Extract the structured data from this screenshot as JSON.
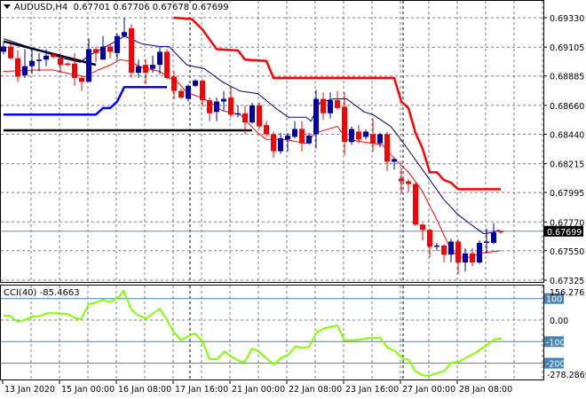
{
  "header": {
    "symbol": "AUDUSD,H4",
    "open": "0.67701",
    "high": "0.67706",
    "low": "0.67678",
    "close": "0.67699"
  },
  "colors": {
    "bull": "#0000b0",
    "bear": "#ff0000",
    "ma_slow": "#000080",
    "ma_fast": "#ff0000",
    "stop_red": "#ff0000",
    "stop_blue": "#0000ff",
    "trend": "#000000",
    "cci": "#7fff00",
    "level_box": "#4682b4",
    "grid": "#708090"
  },
  "price_axis": {
    "labels": [
      "0.69330",
      "0.69105",
      "0.68885",
      "0.68660",
      "0.68440",
      "0.68215",
      "0.67995",
      "0.67770",
      "0.67550",
      "0.67325"
    ],
    "current_price": "0.67699"
  },
  "time_axis": {
    "labels": [
      {
        "i": 0,
        "text": "13 Jan 2020"
      },
      {
        "i": 8,
        "text": "15 Jan 00:00"
      },
      {
        "i": 16,
        "text": "16 Jan 08:00"
      },
      {
        "i": 24,
        "text": "17 Jan 16:00"
      },
      {
        "i": 32,
        "text": "21 Jan 00:00"
      },
      {
        "i": 40,
        "text": "22 Jan 08:00"
      },
      {
        "i": 48,
        "text": "23 Jan 16:00"
      },
      {
        "i": 56,
        "text": "27 Jan 00:00"
      },
      {
        "i": 64,
        "text": "28 Jan 08:00"
      }
    ],
    "period_separators": [
      26,
      56
    ]
  },
  "cci_panel": {
    "label": "CCI(40) -85.4663",
    "max_label": "156.276",
    "min_label": "-278.2869",
    "zero_label": "0.00",
    "levels": [
      "100",
      "-100",
      "-200"
    ]
  },
  "chart_data": {
    "type": "candlestick",
    "title": "AUDUSD,H4",
    "ylim": [
      0.67325,
      0.6933
    ],
    "candles": [
      [
        0.6907,
        0.6914,
        0.6905,
        0.6911
      ],
      [
        0.6911,
        0.6913,
        0.6901,
        0.6902
      ],
      [
        0.6902,
        0.6908,
        0.6884,
        0.6888
      ],
      [
        0.6889,
        0.6909,
        0.6887,
        0.6896
      ],
      [
        0.6896,
        0.6909,
        0.689,
        0.69
      ],
      [
        0.69,
        0.6906,
        0.6892,
        0.6901
      ],
      [
        0.6901,
        0.6909,
        0.6896,
        0.6904
      ],
      [
        0.6905,
        0.6906,
        0.6902,
        0.6903
      ],
      [
        0.6902,
        0.6906,
        0.6891,
        0.6897
      ],
      [
        0.6898,
        0.6899,
        0.6896,
        0.6897
      ],
      [
        0.6898,
        0.6906,
        0.6881,
        0.6887
      ],
      [
        0.6887,
        0.6888,
        0.6877,
        0.6884
      ],
      [
        0.6884,
        0.6917,
        0.6884,
        0.6909
      ],
      [
        0.6909,
        0.6911,
        0.6899,
        0.6906
      ],
      [
        0.6901,
        0.6919,
        0.6901,
        0.6911
      ],
      [
        0.6911,
        0.6913,
        0.6902,
        0.6907
      ],
      [
        0.6906,
        0.6921,
        0.6901,
        0.6919
      ],
      [
        0.6919,
        0.6933,
        0.6918,
        0.6922
      ],
      [
        0.6925,
        0.6928,
        0.6887,
        0.6891
      ],
      [
        0.6891,
        0.6901,
        0.6887,
        0.6896
      ],
      [
        0.6897,
        0.6901,
        0.6882,
        0.6891
      ],
      [
        0.6894,
        0.6904,
        0.6891,
        0.6897
      ],
      [
        0.6897,
        0.6911,
        0.689,
        0.6907
      ],
      [
        0.6907,
        0.6909,
        0.6886,
        0.6887
      ],
      [
        0.6888,
        0.6892,
        0.6871,
        0.6877
      ],
      [
        0.6877,
        0.6879,
        0.6871,
        0.6872
      ],
      [
        0.6871,
        0.6882,
        0.6869,
        0.6881
      ],
      [
        0.6881,
        0.6886,
        0.688,
        0.6885
      ],
      [
        0.6885,
        0.6886,
        0.6865,
        0.687
      ],
      [
        0.687,
        0.6872,
        0.6854,
        0.686
      ],
      [
        0.6861,
        0.6872,
        0.6854,
        0.6869
      ],
      [
        0.6869,
        0.6877,
        0.6862,
        0.6871
      ],
      [
        0.6872,
        0.688,
        0.6857,
        0.6859
      ],
      [
        0.6859,
        0.6866,
        0.6857,
        0.686
      ],
      [
        0.686,
        0.6866,
        0.6844,
        0.6853
      ],
      [
        0.6853,
        0.6868,
        0.6852,
        0.6866
      ],
      [
        0.6866,
        0.6868,
        0.6848,
        0.685
      ],
      [
        0.6851,
        0.6854,
        0.6842,
        0.6844
      ],
      [
        0.6844,
        0.6846,
        0.6826,
        0.6831
      ],
      [
        0.6831,
        0.6845,
        0.6829,
        0.6841
      ],
      [
        0.684,
        0.6845,
        0.6831,
        0.6843
      ],
      [
        0.6842,
        0.6854,
        0.6841,
        0.6848
      ],
      [
        0.6848,
        0.6854,
        0.6831,
        0.6837
      ],
      [
        0.6837,
        0.6845,
        0.6836,
        0.6843
      ],
      [
        0.6844,
        0.6878,
        0.6833,
        0.6871
      ],
      [
        0.6871,
        0.6876,
        0.6855,
        0.686
      ],
      [
        0.686,
        0.6876,
        0.6856,
        0.687
      ],
      [
        0.687,
        0.6877,
        0.6863,
        0.6864
      ],
      [
        0.6865,
        0.6876,
        0.6828,
        0.6838
      ],
      [
        0.6838,
        0.685,
        0.6836,
        0.6848
      ],
      [
        0.6846,
        0.6851,
        0.6837,
        0.684
      ],
      [
        0.6842,
        0.6848,
        0.684,
        0.6846
      ],
      [
        0.6844,
        0.6856,
        0.6831,
        0.6837
      ],
      [
        0.6837,
        0.6845,
        0.6834,
        0.6844
      ],
      [
        0.6844,
        0.6846,
        0.6816,
        0.6823
      ],
      [
        0.6823,
        0.6826,
        0.6817,
        0.6825
      ],
      [
        0.681,
        0.6818,
        0.6799,
        0.6808
      ],
      [
        0.6808,
        0.681,
        0.68,
        0.6806
      ],
      [
        0.6806,
        0.6807,
        0.6774,
        0.6775
      ],
      [
        0.6775,
        0.6776,
        0.6763,
        0.6771
      ],
      [
        0.6771,
        0.6772,
        0.675,
        0.6758
      ],
      [
        0.6758,
        0.6761,
        0.6755,
        0.6759
      ],
      [
        0.6759,
        0.676,
        0.6746,
        0.6752
      ],
      [
        0.6752,
        0.6764,
        0.6746,
        0.6762
      ],
      [
        0.6762,
        0.6764,
        0.6737,
        0.6746
      ],
      [
        0.6746,
        0.6757,
        0.6739,
        0.6753
      ],
      [
        0.6753,
        0.6757,
        0.6743,
        0.6746
      ],
      [
        0.6746,
        0.6763,
        0.6745,
        0.6761
      ],
      [
        0.6761,
        0.6772,
        0.6753,
        0.6762
      ],
      [
        0.6761,
        0.6776,
        0.676,
        0.6769
      ],
      [
        0.67701,
        0.67706,
        0.67678,
        0.67699
      ]
    ],
    "ma_slow": [
      [
        0,
        0.6917
      ],
      [
        4.5,
        0.6909
      ],
      [
        8.3,
        0.6902
      ],
      [
        10.8,
        0.6899
      ],
      [
        12,
        0.6904
      ],
      [
        15.8,
        0.6915
      ],
      [
        17,
        0.6919
      ],
      [
        19.5,
        0.6913
      ],
      [
        22,
        0.6911
      ],
      [
        23.3,
        0.6911
      ],
      [
        25.8,
        0.6897
      ],
      [
        28.3,
        0.6894
      ],
      [
        30.8,
        0.6884
      ],
      [
        33.3,
        0.6877
      ],
      [
        35.8,
        0.6875
      ],
      [
        38.3,
        0.6864
      ],
      [
        40.1,
        0.6857
      ],
      [
        42.6,
        0.6857
      ],
      [
        43.3,
        0.6854
      ],
      [
        44.5,
        0.6868
      ],
      [
        46.4,
        0.6871
      ],
      [
        48.3,
        0.6871
      ],
      [
        50.8,
        0.6861
      ],
      [
        52,
        0.6859
      ],
      [
        54.5,
        0.685
      ],
      [
        55.8,
        0.6841
      ],
      [
        57,
        0.6832
      ],
      [
        59.5,
        0.6813
      ],
      [
        62,
        0.6794
      ],
      [
        63.9,
        0.6783
      ],
      [
        65.8,
        0.6775
      ],
      [
        67.6,
        0.6768
      ],
      [
        68.9,
        0.6769
      ],
      [
        69.8,
        0.6771
      ]
    ],
    "ma_fast": [
      [
        0,
        0.6892
      ],
      [
        4.5,
        0.6893
      ],
      [
        7,
        0.6893
      ],
      [
        9.5,
        0.689
      ],
      [
        11.4,
        0.6888
      ],
      [
        13.3,
        0.6893
      ],
      [
        15.1,
        0.6897
      ],
      [
        16.4,
        0.6901
      ],
      [
        17.6,
        0.69
      ],
      [
        19.5,
        0.6895
      ],
      [
        22,
        0.6892
      ],
      [
        23.3,
        0.6887
      ],
      [
        24.5,
        0.6884
      ],
      [
        25.8,
        0.6876
      ],
      [
        28.3,
        0.6871
      ],
      [
        30.8,
        0.6862
      ],
      [
        33.3,
        0.6859
      ],
      [
        35.8,
        0.6845
      ],
      [
        37,
        0.684
      ],
      [
        39.5,
        0.684
      ],
      [
        42.6,
        0.6837
      ],
      [
        43.9,
        0.6845
      ],
      [
        47,
        0.685
      ],
      [
        48.3,
        0.684
      ],
      [
        50.8,
        0.6838
      ],
      [
        53.3,
        0.6836
      ],
      [
        55.1,
        0.6825
      ],
      [
        57,
        0.6815
      ],
      [
        58.9,
        0.6801
      ],
      [
        60.8,
        0.6781
      ],
      [
        62.6,
        0.676
      ],
      [
        63.9,
        0.675
      ],
      [
        65.8,
        0.675
      ],
      [
        67,
        0.6753
      ],
      [
        70,
        0.6755
      ]
    ],
    "stop_red": [
      [
        24,
        0.6933
      ],
      [
        26.5,
        0.6932
      ],
      [
        28,
        0.6924
      ],
      [
        30,
        0.6909
      ],
      [
        33,
        0.6908
      ],
      [
        34,
        0.6901
      ],
      [
        37,
        0.69
      ],
      [
        38,
        0.6887
      ],
      [
        55,
        0.6887
      ],
      [
        56,
        0.6869
      ],
      [
        57,
        0.6864
      ],
      [
        58,
        0.6845
      ],
      [
        59,
        0.6833
      ],
      [
        60,
        0.6815
      ],
      [
        61,
        0.6815
      ],
      [
        62,
        0.6809
      ],
      [
        63,
        0.6807
      ],
      [
        64,
        0.6802
      ],
      [
        70,
        0.6802
      ]
    ],
    "stop_blue": [
      [
        0,
        0.6859
      ],
      [
        13,
        0.6859
      ],
      [
        14,
        0.6864
      ],
      [
        15,
        0.6864
      ],
      [
        16,
        0.6869
      ],
      [
        17,
        0.688
      ],
      [
        23,
        0.688
      ]
    ],
    "trend_lines": [
      [
        [
          0,
          0.6915
        ],
        [
          13,
          0.6897
        ]
      ],
      [
        [
          0,
          0.6847
        ],
        [
          35,
          0.6847
        ]
      ]
    ],
    "cci": {
      "ylim": [
        -278.2869,
        156.276
      ],
      "levels": [
        100,
        0,
        -100,
        -200
      ],
      "points": [
        [
          0,
          21
        ],
        [
          0.9,
          21
        ],
        [
          1.9,
          -7
        ],
        [
          2.9,
          0
        ],
        [
          4,
          17
        ],
        [
          5,
          17
        ],
        [
          6.1,
          32
        ],
        [
          7.4,
          32
        ],
        [
          9,
          28
        ],
        [
          10,
          11
        ],
        [
          10.9,
          3
        ],
        [
          12,
          74
        ],
        [
          13,
          81
        ],
        [
          14,
          94
        ],
        [
          15,
          83
        ],
        [
          16.1,
          104
        ],
        [
          16.9,
          136
        ],
        [
          18,
          49
        ],
        [
          19,
          21
        ],
        [
          20.1,
          7
        ],
        [
          21.1,
          32
        ],
        [
          22,
          53
        ],
        [
          23,
          0
        ],
        [
          24,
          -58
        ],
        [
          25,
          -93
        ],
        [
          25.9,
          -76
        ],
        [
          26.9,
          -62
        ],
        [
          28,
          -97
        ],
        [
          29,
          -181
        ],
        [
          30.1,
          -181
        ],
        [
          31.1,
          -146
        ],
        [
          32.3,
          -174
        ],
        [
          33.3,
          -192
        ],
        [
          34,
          -192
        ],
        [
          35,
          -132
        ],
        [
          35.9,
          -146
        ],
        [
          37,
          -178
        ],
        [
          38.1,
          -206
        ],
        [
          39.1,
          -174
        ],
        [
          40.1,
          -160
        ],
        [
          41.1,
          -122
        ],
        [
          42,
          -129
        ],
        [
          43,
          -125
        ],
        [
          44.1,
          -56
        ],
        [
          45.1,
          -39
        ],
        [
          45.9,
          -32
        ],
        [
          47,
          -25
        ],
        [
          48,
          -94
        ],
        [
          49.4,
          -93
        ],
        [
          50.4,
          -90
        ],
        [
          51.5,
          -83
        ],
        [
          53,
          -83
        ],
        [
          54.1,
          -129
        ],
        [
          55.1,
          -143
        ],
        [
          56.3,
          -181
        ],
        [
          57,
          -183
        ],
        [
          58,
          -239
        ],
        [
          59.1,
          -257
        ],
        [
          60.1,
          -257
        ],
        [
          61.3,
          -243
        ],
        [
          62,
          -239
        ],
        [
          63,
          -199
        ],
        [
          64.1,
          -194
        ],
        [
          65.4,
          -169
        ],
        [
          66.5,
          -150
        ],
        [
          67.8,
          -122
        ],
        [
          69.1,
          -90
        ],
        [
          70.1,
          -85.4663
        ]
      ]
    }
  }
}
